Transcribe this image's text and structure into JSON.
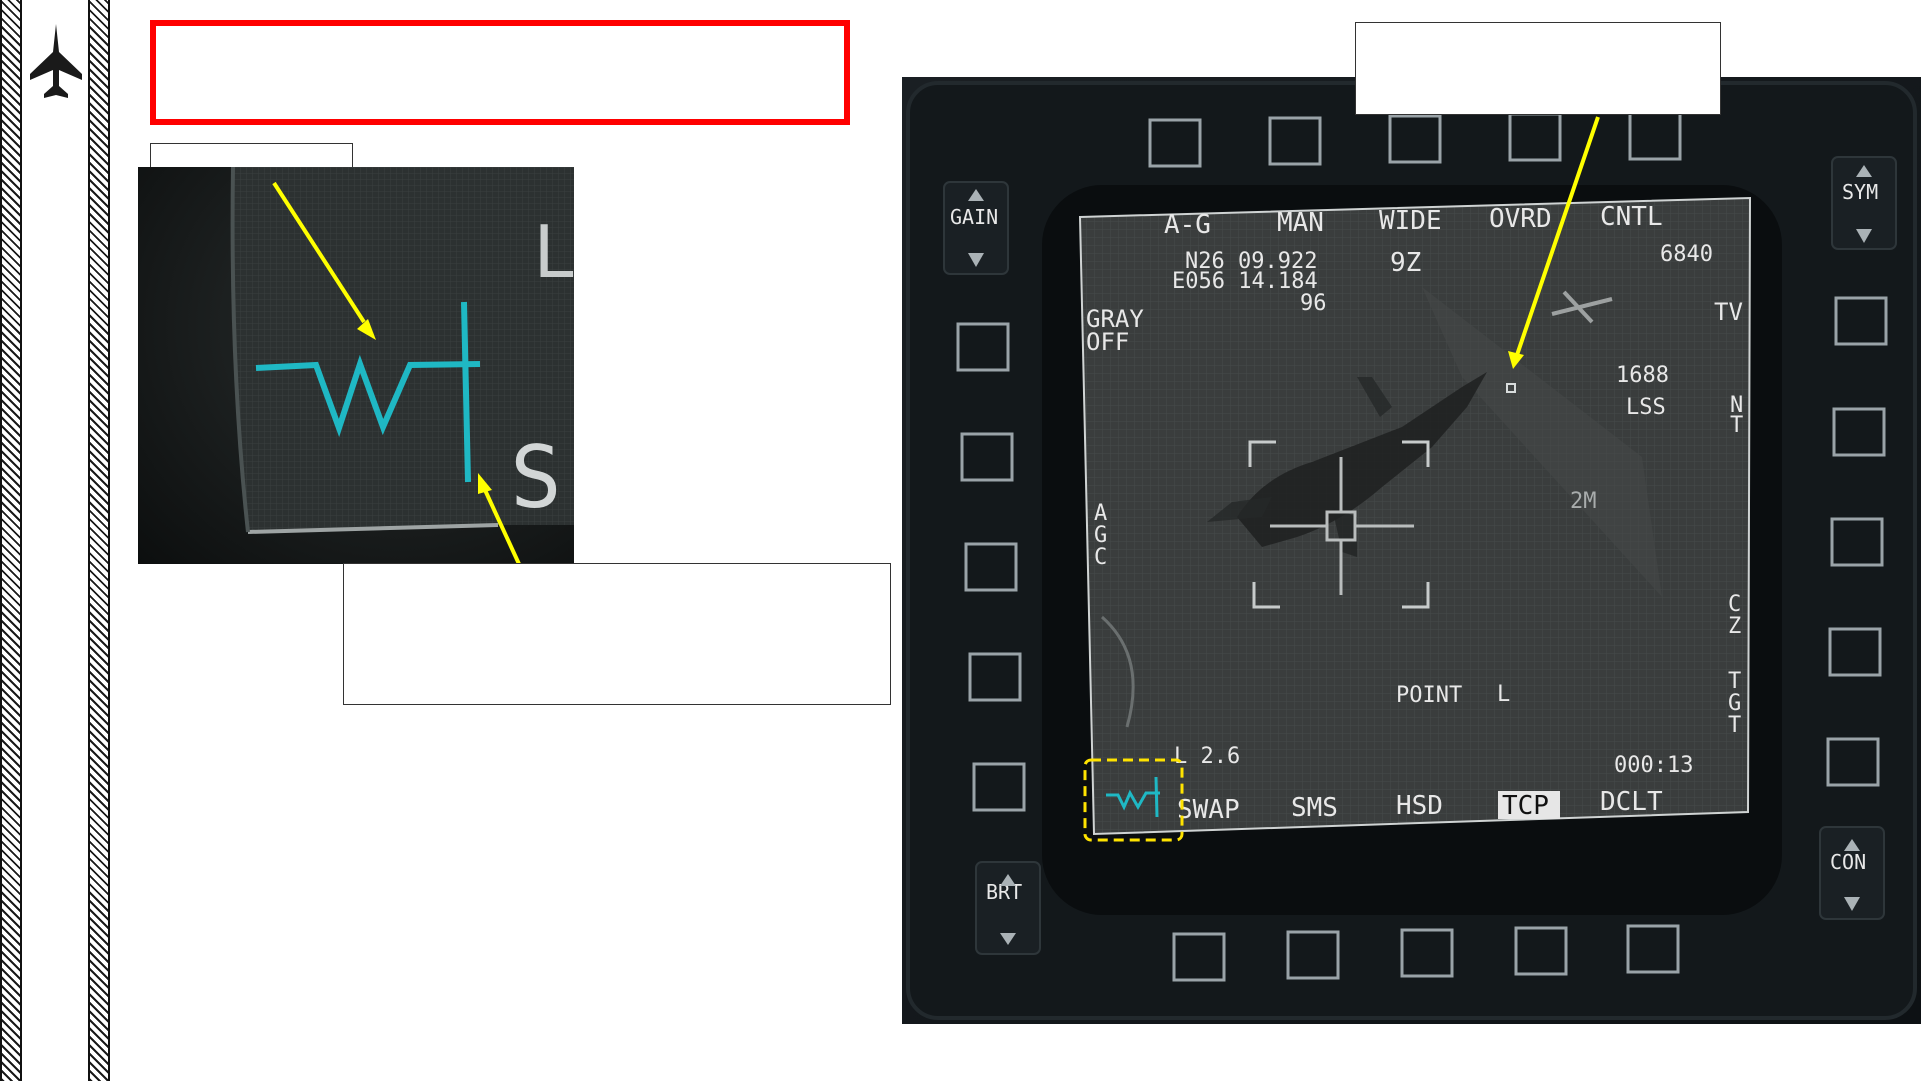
{
  "mfd": {
    "top_row": [
      "A-G",
      "MAN",
      "WIDE",
      "OVRD",
      "CNTL"
    ],
    "coord_n": "N26 09.922",
    "coord_e": "E056 14.184",
    "elevation": "96",
    "zoom_code": "9Z",
    "altitude": "6840",
    "gray_line1": "GRAY",
    "gray_line2": "OFF",
    "tv": "TV",
    "range_value": "1688",
    "lss": "LSS",
    "nt_n": "N",
    "nt_t": "T",
    "agc_a": "A",
    "agc_g": "G",
    "agc_c": "C",
    "two_m": "2M",
    "cz_c": "C",
    "cz_z": "Z",
    "tgt_t1": "T",
    "tgt_g": "G",
    "tgt_t2": "T",
    "point": "POINT",
    "point_side": "L",
    "laser_value": "L 2.6",
    "timer": "000:13",
    "bottom_row": [
      "SWAP",
      "SMS",
      "HSD",
      "TCP",
      "DCLT"
    ],
    "gain_label": "GAIN",
    "sym_label": "SYM",
    "brt_label": "BRT",
    "con_label": "CON"
  },
  "zoom_letters": {
    "l": "L",
    "s": "S"
  },
  "colors": {
    "accent_red": "#ff0000",
    "arrow_yellow": "#ffff00",
    "scan_cyan": "#1fb8c4",
    "highlight_yellow": "#ffe300"
  }
}
